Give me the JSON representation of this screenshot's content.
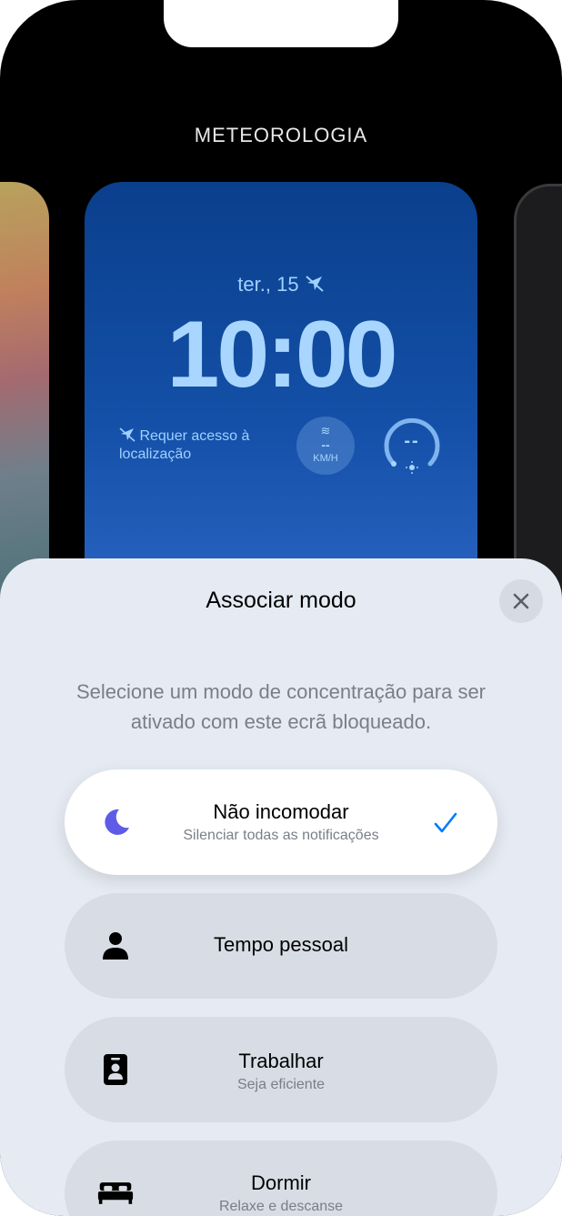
{
  "gallery": {
    "title": "METEOROLOGIA"
  },
  "preview": {
    "date": "ter., 15",
    "time": "10:00",
    "location_notice": "Requer acesso à localização",
    "wind": {
      "value": "--",
      "unit": "KM/H"
    },
    "uv": {
      "value": "--"
    }
  },
  "sheet": {
    "title": "Associar modo",
    "description": "Selecione um modo de concentração para ser ativado com este ecrã bloqueado.",
    "modes": [
      {
        "title": "Não incomodar",
        "subtitle": "Silenciar todas as notificações",
        "icon": "moon-icon",
        "selected": true
      },
      {
        "title": "Tempo pessoal",
        "subtitle": "",
        "icon": "person-icon",
        "selected": false
      },
      {
        "title": "Trabalhar",
        "subtitle": "Seja eficiente",
        "icon": "id-badge-icon",
        "selected": false
      },
      {
        "title": "Dormir",
        "subtitle": "Relaxe e descanse",
        "icon": "bed-icon",
        "selected": false
      }
    ]
  },
  "colors": {
    "accent": "#007aff",
    "moon": "#5e5ce6",
    "sheet_background": "#e6ebf3",
    "preview_background": "#1450a8"
  }
}
